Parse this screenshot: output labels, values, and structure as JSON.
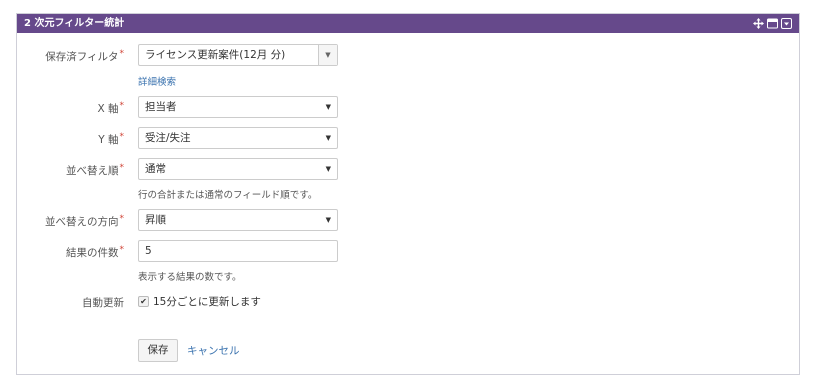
{
  "gadget": {
    "title": "2 次元フィルター統計"
  },
  "form": {
    "saved_filter": {
      "label": "保存済フィルタ",
      "value": "ライセンス更新案件(12月 分)",
      "link": "詳細検索"
    },
    "x_axis": {
      "label": "X 軸",
      "value": "担当者"
    },
    "y_axis": {
      "label": "Y 軸",
      "value": "受注/失注"
    },
    "sort_by": {
      "label": "並べ替え順",
      "value": "通常",
      "help": "行の合計または通常のフィールド順です。"
    },
    "sort_direction": {
      "label": "並べ替えの方向",
      "value": "昇順"
    },
    "num_results": {
      "label": "結果の件数",
      "value": "5",
      "help": "表示する結果の数です。"
    },
    "auto_refresh": {
      "label": "自動更新",
      "checkbox_label": "15分ごとに更新します",
      "checked": true
    },
    "required_mark": "*"
  },
  "actions": {
    "save": "保存",
    "cancel": "キャンセル"
  },
  "colors": {
    "titlebar": "#66498b",
    "link": "#3b73af",
    "required": "#d04437"
  },
  "icons": [
    "move-icon",
    "maximize-icon",
    "dropdown-menu-icon",
    "checkmark-icon",
    "caret-down-icon"
  ]
}
